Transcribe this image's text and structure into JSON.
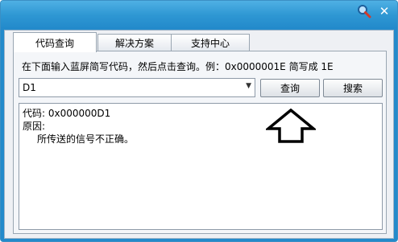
{
  "window": {
    "close_glyph": "✕"
  },
  "tabs": [
    {
      "label": "代码查询",
      "active": true
    },
    {
      "label": "解决方案",
      "active": false
    },
    {
      "label": "支持中心",
      "active": false
    }
  ],
  "query_panel": {
    "hint": "在下面输入蓝屏简写代码，然后点击查询。例：0x0000001E 简写成 1E",
    "code_input_value": "D1",
    "query_button_label": "查询",
    "search_button_label": "搜索"
  },
  "result": {
    "code_line": "代码: 0x000000D1",
    "reason_label": "原因:",
    "reason_text": "所传送的信号不正确。"
  },
  "colors": {
    "title_bar": "#2e97d3",
    "client_bg": "#eef0f4"
  },
  "icons": [
    "magnifier-icon",
    "close-icon",
    "dropdown-arrow-icon",
    "up-arrow-annotation"
  ]
}
